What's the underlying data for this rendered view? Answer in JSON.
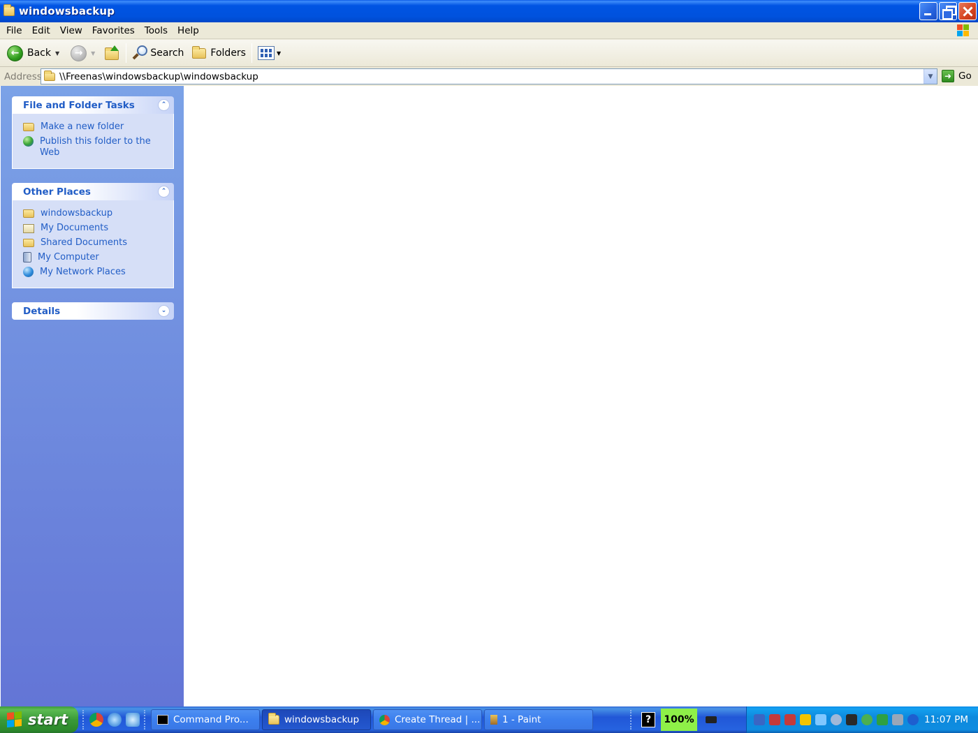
{
  "window": {
    "title": "windowsbackup"
  },
  "menubar": {
    "items": [
      "File",
      "Edit",
      "View",
      "Favorites",
      "Tools",
      "Help"
    ]
  },
  "toolbar": {
    "back_label": "Back",
    "search_label": "Search",
    "folders_label": "Folders"
  },
  "address": {
    "label": "Address",
    "value": "\\\\Freenas\\windowsbackup\\windowsbackup",
    "go_label": "Go"
  },
  "taskpane": {
    "file_folder_tasks": {
      "title": "File and Folder Tasks",
      "items": [
        "Make a new folder",
        "Publish this folder to the Web"
      ]
    },
    "other_places": {
      "title": "Other Places",
      "items": [
        "windowsbackup",
        "My Documents",
        "Shared Documents",
        "My Computer",
        "My Network Places"
      ]
    },
    "details": {
      "title": "Details"
    }
  },
  "taskbar": {
    "start_label": "start",
    "buttons": [
      "Command Pro...",
      "windowsbackup",
      "Create Thread | ...",
      "1 - Paint"
    ],
    "battery": "100%",
    "help_glyph": "?",
    "clock": "11:07 PM"
  },
  "icons": {
    "title": "folder-icon",
    "back": "back-arrow-icon",
    "forward": "forward-arrow-icon",
    "up": "up-folder-icon",
    "search": "search-icon",
    "folders": "folders-icon",
    "views": "views-icon"
  },
  "colors": {
    "titlebar": "#0054E3",
    "taskpane_top": "#7BA2E7",
    "taskpane_bottom": "#6375D6",
    "link": "#215DC6",
    "start_green": "#3A9A38",
    "battery_green": "#8EF048"
  }
}
